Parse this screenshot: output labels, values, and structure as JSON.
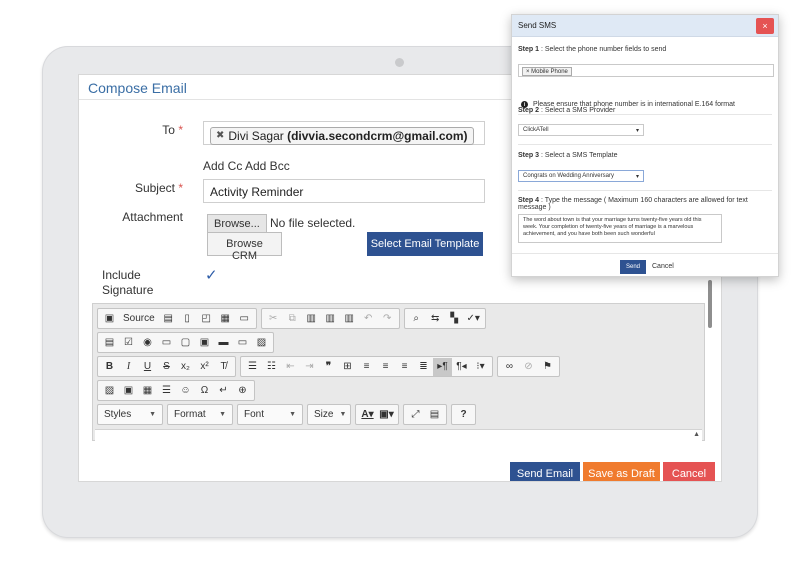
{
  "compose": {
    "title": "Compose Email",
    "to_label": "To",
    "to_recipient_name": "Divi Sagar",
    "to_recipient_email": "(divvia.secondcrm@gmail.com)",
    "add_cc": "Add Cc",
    "add_bcc": "Add Bcc",
    "subject_label": "Subject",
    "subject_value": "Activity Reminder",
    "attachment_label": "Attachment",
    "browse_label": "Browse...",
    "no_file_text": "No file selected.",
    "browse_crm_label": "Browse CRM",
    "select_template_label": "Select Email Template",
    "include_signature_label_line1": "Include",
    "include_signature_label_line2": "Signature",
    "signature_checked": true,
    "required_mark": "*"
  },
  "editor": {
    "source_label": "Source",
    "styles_label": "Styles",
    "format_label": "Format",
    "font_label": "Font",
    "size_label": "Size",
    "help_label": "?"
  },
  "actions": {
    "send_email": "Send Email",
    "save_draft": "Save as Draft",
    "cancel": "Cancel"
  },
  "sms_modal": {
    "title": "Send SMS",
    "close_icon": "×",
    "step1_label": "Step 1",
    "step1_text": ":  Select the phone number fields to send",
    "phone_field_chip": "Mobile Phone",
    "notice": "Please ensure that phone number is in international E.164 format",
    "step2_label": "Step 2",
    "step2_text": ":  Select a SMS Provider",
    "provider_value": "ClickATell",
    "step3_label": "Step 3",
    "step3_text": ":  Select a SMS Template",
    "template_value": "Congrats on Wedding Anniversary",
    "step4_label": "Step 4",
    "step4_text": ":  Type the message ( Maximum 160 characters are allowed for text message )",
    "message": "The word about town is that your marriage turns twenty-five years old this week. Your completion of twenty-five years of marriage is a marvelous achievement, and you have both been such wonderful",
    "send_label": "Send",
    "cancel_label": "Cancel"
  },
  "colors": {
    "primary": "#2e5291",
    "draft": "#f07b2e",
    "cancel": "#e55353",
    "title_blue": "#3a6ea5"
  }
}
